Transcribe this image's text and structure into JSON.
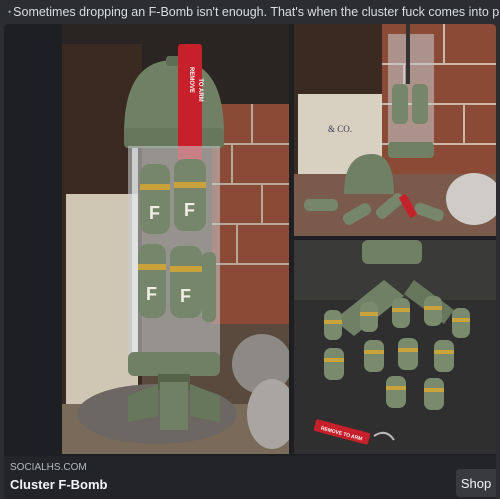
{
  "message": {
    "text": "Sometimes dropping an F-Bomb isn't enough. That's when the cluster fuck comes into play."
  },
  "embed": {
    "site": "SOCIALHS.COM",
    "title": "Cluster F-Bomb",
    "action_label": "Shop",
    "gallery": [
      {
        "name": "cluster-bomb-photo-main",
        "subject": "clear cluster bomb casing with tag, filled with small F bombs"
      },
      {
        "name": "cluster-bomb-photo-top-right",
        "subject": "opened casing with mini bombs scattered"
      },
      {
        "name": "cluster-bomb-photo-bottom-right",
        "subject": "mini F bombs standing on surface with tag"
      }
    ]
  },
  "photo_text": {
    "tag_line1": "REMOVE",
    "tag_line2": "TO ARM",
    "bomb_letter": "F",
    "small_tag": "REMOVE TO ARM",
    "jar_label": "& CO."
  },
  "colors": {
    "background": "#2b2d31",
    "embed_bg": "#1e1f22",
    "bomb_green": "#6f8064",
    "tag_red": "#c8202b",
    "bomb_band": "#c9a23c"
  }
}
